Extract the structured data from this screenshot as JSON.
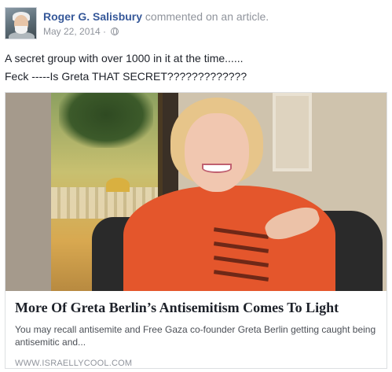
{
  "post": {
    "author": "Roger G. Salisbury",
    "action": " commented on an article.",
    "date": "May 22, 2014",
    "separator": " ·",
    "privacy_icon": "globe-icon",
    "text_lines": [
      "A secret group with over 1000 in it at the time......",
      "Feck -----Is Greta THAT SECRET?????????????"
    ]
  },
  "attachment": {
    "headline": "More Of Greta Berlin’s Antisemitism Comes To Light",
    "description": "You may recall antisemite and Free Gaza co-founder Greta Berlin getting caught being antisemitic and...",
    "source": "WWW.ISRAELLYCOOL.COM"
  },
  "colors": {
    "author_link": "#365899",
    "meta": "#90949c",
    "border": "#dddfe2"
  }
}
